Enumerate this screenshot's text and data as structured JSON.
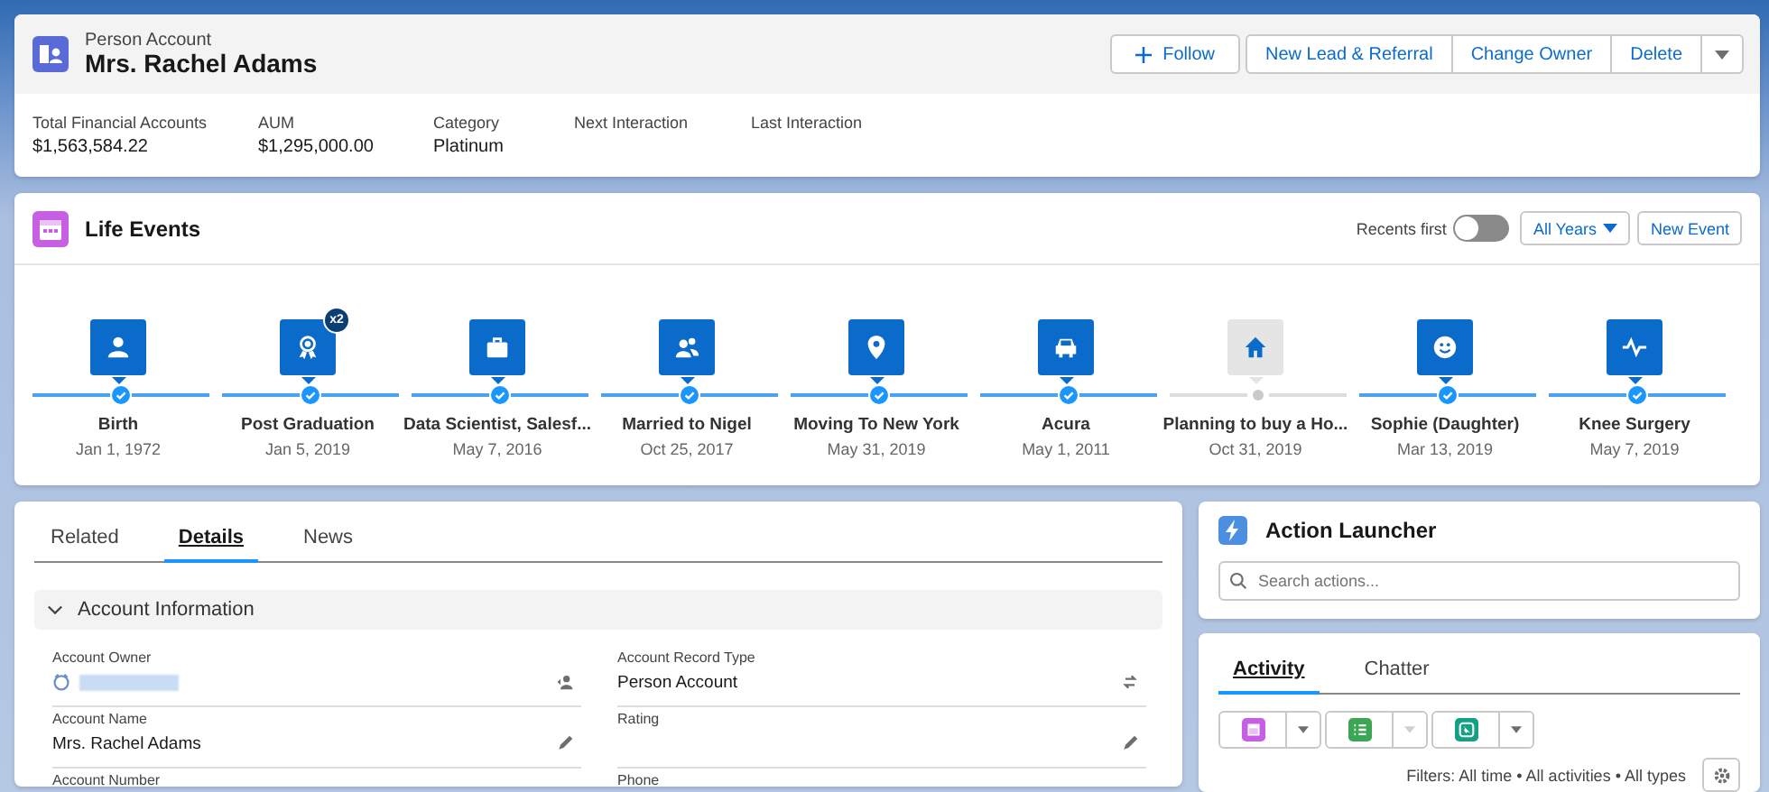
{
  "header": {
    "object_type": "Person Account",
    "title": "Mrs. Rachel Adams",
    "actions": [
      {
        "label": "Follow",
        "kind": "follow"
      },
      {
        "label": "New Lead & Referral",
        "kind": "plain"
      },
      {
        "label": "Change Owner",
        "kind": "plain"
      },
      {
        "label": "Delete",
        "kind": "plain"
      },
      {
        "kind": "menu"
      }
    ],
    "stats": [
      {
        "label": "Total Financial Accounts",
        "value": "$1,563,584.22"
      },
      {
        "label": "AUM",
        "value": "$1,295,000.00"
      },
      {
        "label": "Category",
        "value": "Platinum"
      },
      {
        "label": "Next Interaction"
      },
      {
        "label": "Last Interaction"
      }
    ]
  },
  "life_events": {
    "title": "Life Events",
    "recents_first": {
      "label": "Recents first",
      "on": false
    },
    "year_filter": "All Years",
    "new_button": "New Event",
    "events": [
      {
        "kind": "person",
        "title": "Birth",
        "date": "Jan 1, 1972",
        "completed": true
      },
      {
        "kind": "award",
        "title": "Post Graduation",
        "date": "Jan 5, 2019",
        "completed": true,
        "badge": "x2"
      },
      {
        "kind": "briefcase",
        "title": "Data Scientist, Salesf...",
        "date": "May 7, 2016",
        "completed": true
      },
      {
        "kind": "couple",
        "title": "Married to Nigel",
        "date": "Oct 25, 2017",
        "completed": true
      },
      {
        "kind": "pin",
        "title": "Moving To New York",
        "date": "May 31, 2019",
        "completed": true
      },
      {
        "kind": "car",
        "title": "Acura",
        "date": "May 1, 2011",
        "completed": true
      },
      {
        "kind": "home",
        "title": "Planning to buy a Ho...",
        "date": "Oct 31, 2019",
        "completed": false
      },
      {
        "kind": "smile",
        "title": "Sophie (Daughter)",
        "date": "Mar 13, 2019",
        "completed": true
      },
      {
        "kind": "pulse",
        "title": "Knee Surgery",
        "date": "May 7, 2019",
        "completed": true
      }
    ]
  },
  "record_tabs": [
    {
      "label": "Related",
      "selected": false
    },
    {
      "label": "Details",
      "selected": true
    },
    {
      "label": "News",
      "selected": false
    }
  ],
  "section": {
    "title": "Account Information",
    "expanded": true,
    "fields": [
      {
        "label": "Account Owner",
        "kind": "owner"
      },
      {
        "label": "Account Record Type",
        "value": "Person Account",
        "kind": "record-type"
      },
      {
        "label": "Account Name",
        "value": "Mrs. Rachel Adams",
        "kind": "editable"
      },
      {
        "label": "Rating",
        "kind": "editable"
      },
      {
        "label": "Account Number"
      },
      {
        "label": "Phone"
      }
    ]
  },
  "action_launcher": {
    "title": "Action Launcher",
    "search": {
      "placeholder": "Search actions..."
    }
  },
  "activity": {
    "tabs": [
      {
        "label": "Activity",
        "selected": true
      },
      {
        "label": "Chatter",
        "selected": false
      }
    ],
    "quick_actions": [
      {
        "kind": "event",
        "color": "#c65fe3",
        "menu_disabled": false
      },
      {
        "kind": "task",
        "color": "#3ba755",
        "menu_disabled": true
      },
      {
        "kind": "call",
        "color": "#13a085",
        "menu_disabled": false
      }
    ],
    "filters": "Filters: All time • All activities • All types"
  }
}
